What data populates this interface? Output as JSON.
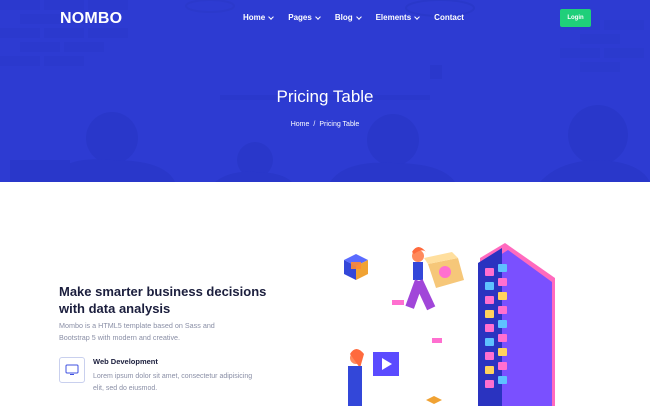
{
  "brand": {
    "logo": "NOMBO"
  },
  "nav": {
    "items": [
      {
        "label": "Home",
        "dropdown": true
      },
      {
        "label": "Pages",
        "dropdown": true
      },
      {
        "label": "Blog",
        "dropdown": true
      },
      {
        "label": "Elements",
        "dropdown": true
      },
      {
        "label": "Contact",
        "dropdown": false
      }
    ],
    "login_label": "Login"
  },
  "hero": {
    "title": "Pricing Table",
    "breadcrumb": {
      "home": "Home",
      "separator": "/",
      "current": "Pricing Table"
    }
  },
  "feature": {
    "title": "Make smarter business decisions with data analysis",
    "description": "Mombo is a HTML5 template based on Sass and Bootstrap 5 with modern and creative.",
    "service": {
      "icon": "monitor-icon",
      "title": "Web Development",
      "text": "Lorem ipsum dolor sit amet, consectetur adipisicing elit, sed do eiusmod."
    }
  },
  "colors": {
    "hero_overlay": "#2838d6",
    "login_button": "#1fcf7a",
    "heading": "#1b1e3d",
    "body_text": "#8a8fa6"
  }
}
